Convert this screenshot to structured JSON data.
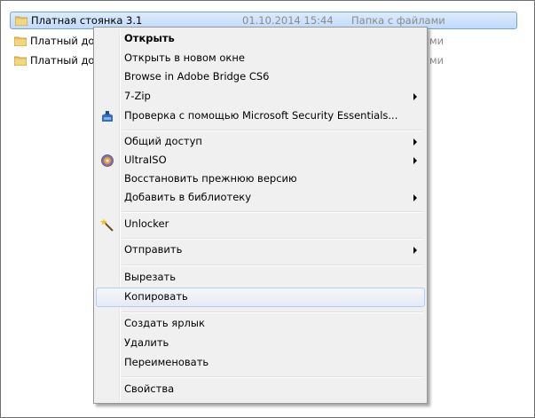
{
  "files": [
    {
      "name": "Платная стоянка 3.1",
      "date": "01.10.2014 15:44",
      "type": "Папка с файлами",
      "selected": true
    },
    {
      "name": "Платный дос",
      "date": "",
      "type": "ми",
      "selected": false
    },
    {
      "name": "Платный дос",
      "date": "",
      "type": "ми",
      "selected": false
    }
  ],
  "menu": {
    "open": "Открыть",
    "open_new_window": "Открыть в новом окне",
    "browse_bridge": "Browse in Adobe Bridge CS6",
    "seven_zip": "7-Zip",
    "mse_scan": "Проверка с помощью Microsoft Security Essentials...",
    "share": "Общий доступ",
    "ultraiso": "UltraISO",
    "restore": "Восстановить прежнюю версию",
    "add_library": "Добавить в библиотеку",
    "unlocker": "Unlocker",
    "send_to": "Отправить",
    "cut": "Вырезать",
    "copy": "Копировать",
    "create_shortcut": "Создать ярлык",
    "delete": "Удалить",
    "rename": "Переименовать",
    "properties": "Свойства"
  },
  "icons": {
    "folder": "folder-icon",
    "mse": "shield-icon",
    "ultraiso": "disc-icon",
    "unlocker": "wand-icon",
    "submenu": "chevron-right-icon"
  },
  "colors": {
    "selection_fill": "#c1dbfc",
    "selection_border": "#7da2ce",
    "menu_bg": "#f0f0f0",
    "hover_border": "#aecff7",
    "muted_text": "#8a8a8a"
  }
}
